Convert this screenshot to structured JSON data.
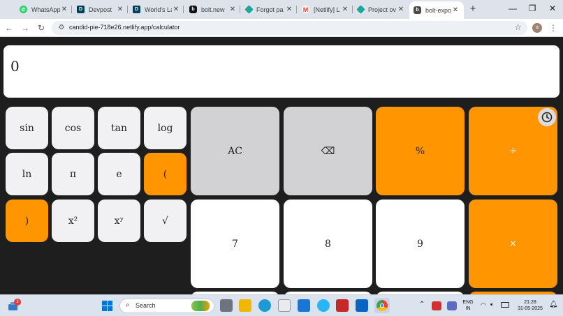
{
  "browser": {
    "tabs": [
      {
        "label": "WhatsApp",
        "icon": "whatsapp-icon",
        "icon_color": "#25d366"
      },
      {
        "label": "Devpost",
        "icon": "devpost-icon",
        "icon_color": "#003e54"
      },
      {
        "label": "World's La",
        "icon": "devpost-icon",
        "icon_color": "#003e54"
      },
      {
        "label": "bolt.new",
        "icon": "bolt-icon",
        "icon_color": "#111111"
      },
      {
        "label": "Forgot pa",
        "icon": "netlify-icon",
        "icon_color": "#19a89d"
      },
      {
        "label": "[Netlify] L",
        "icon": "gmail-icon",
        "icon_color": "#ea4335"
      },
      {
        "label": "Project ov",
        "icon": "netlify-icon",
        "icon_color": "#19a89d"
      },
      {
        "label": "bolt-expo",
        "icon": "bolt-icon",
        "icon_color": "#4a4a4a"
      }
    ],
    "url": "candid-pie-718e26.netlify.app/calculator",
    "profile_initial": "a"
  },
  "calculator": {
    "display": "0",
    "scientific_keys": [
      "sin",
      "cos",
      "tan",
      "log",
      "ln",
      "π",
      "e",
      "(",
      ")",
      "x²",
      "xʸ",
      "√"
    ],
    "main_keys": [
      "AC",
      "⌫",
      "%",
      "÷",
      "7",
      "8",
      "9",
      "×"
    ]
  },
  "taskbar": {
    "notification_badge": "3",
    "search_placeholder": "Search",
    "language_line1": "ENG",
    "language_line2": "IN",
    "time": "21:28",
    "date": "31-05-2025"
  },
  "colors": {
    "orange": "#ff9500",
    "gray_key": "#d2d2d4",
    "sci_key": "#f1f1f3",
    "background": "#1e1e1e"
  }
}
